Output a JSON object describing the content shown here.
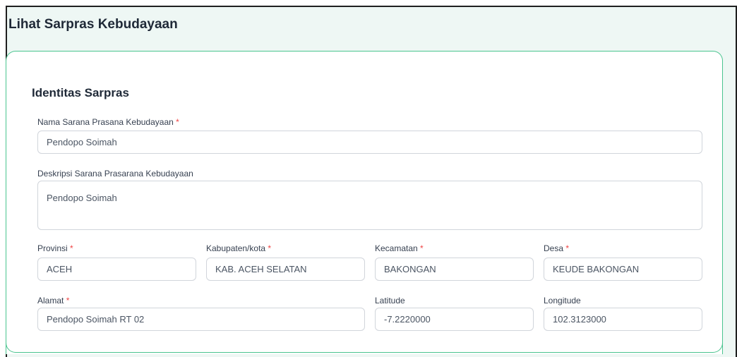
{
  "page": {
    "title": "Lihat Sarpras Kebudayaan"
  },
  "section": {
    "title": "Identitas Sarpras"
  },
  "fields": {
    "nama": {
      "label": "Nama Sarana Prasana Kebudayaan",
      "required": "*",
      "value": "Pendopo Soimah"
    },
    "deskripsi": {
      "label": "Deskripsi Sarana Prasarana Kebudayaan",
      "value": "Pendopo Soimah"
    },
    "provinsi": {
      "label": "Provinsi",
      "required": "*",
      "value": "ACEH"
    },
    "kabupaten": {
      "label": "Kabupaten/kota",
      "required": "*",
      "value": "KAB. ACEH SELATAN"
    },
    "kecamatan": {
      "label": "Kecamatan",
      "required": "*",
      "value": "BAKONGAN"
    },
    "desa": {
      "label": "Desa",
      "required": "*",
      "value": "KEUDE BAKONGAN"
    },
    "alamat": {
      "label": "Alamat",
      "required": "*",
      "value": "Pendopo Soimah RT 02"
    },
    "latitude": {
      "label": "Latitude",
      "value": "-7.2220000"
    },
    "longitude": {
      "label": "Longitude",
      "value": "102.3123000"
    }
  },
  "colors": {
    "accent": "#4ac48f",
    "required": "#ef4444",
    "header_bg": "#eef7f4"
  }
}
